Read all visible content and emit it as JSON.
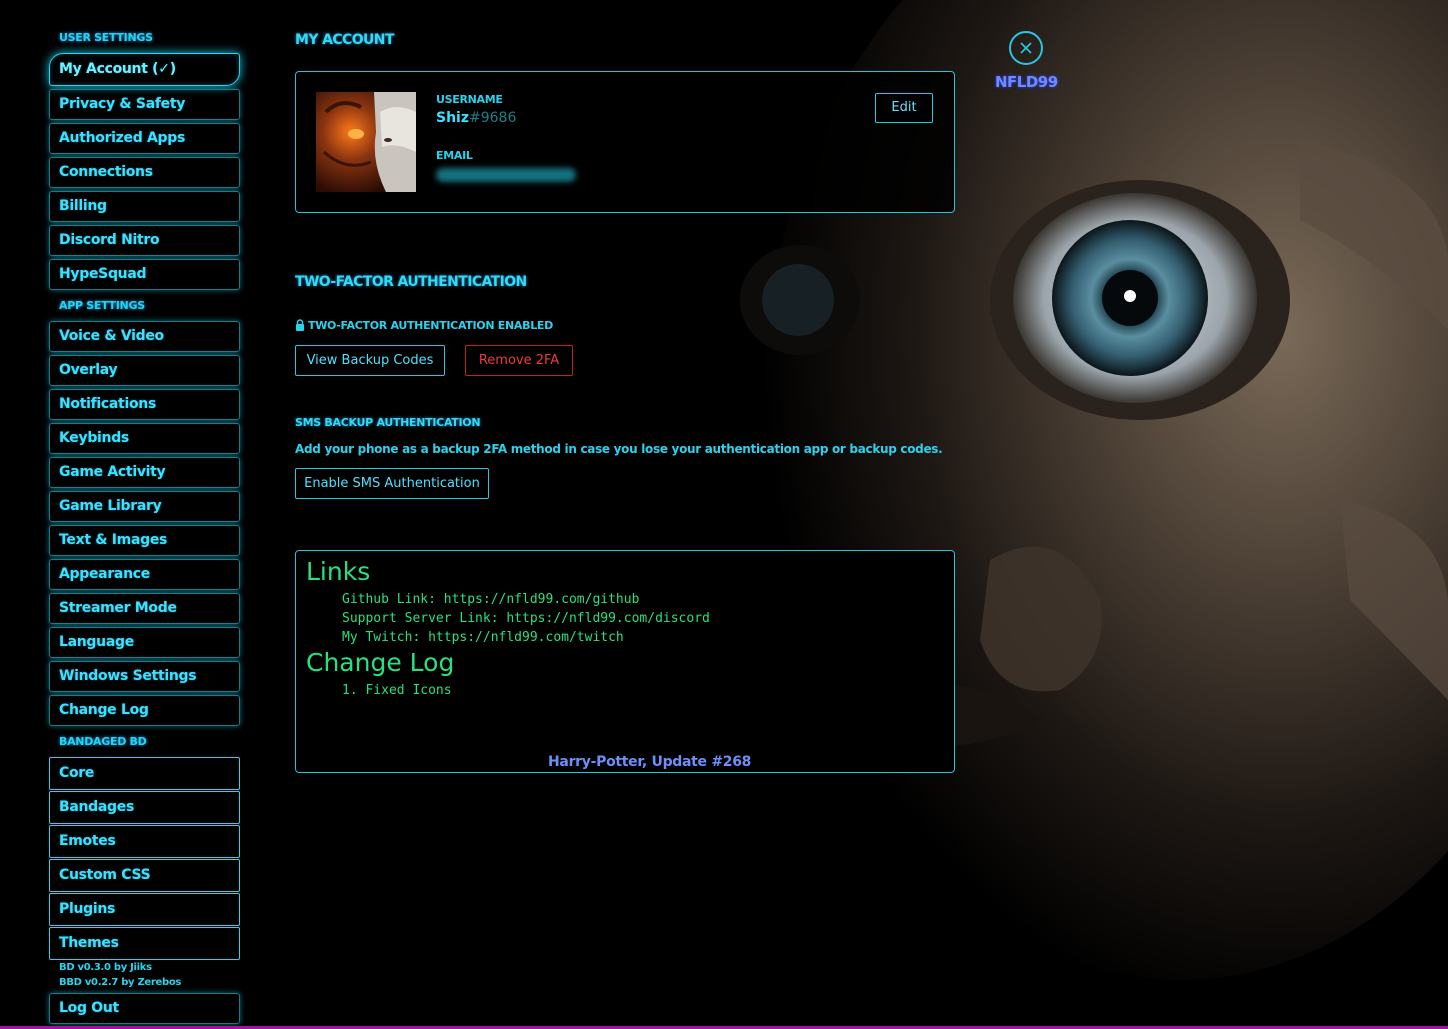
{
  "sidebar": {
    "user_settings_header": "USER SETTINGS",
    "user_items": [
      {
        "label": "My Account (✓)"
      },
      {
        "label": "Privacy & Safety"
      },
      {
        "label": "Authorized Apps"
      },
      {
        "label": "Connections"
      },
      {
        "label": "Billing"
      },
      {
        "label": "Discord Nitro"
      },
      {
        "label": "HypeSquad"
      }
    ],
    "app_settings_header": "APP SETTINGS",
    "app_items": [
      {
        "label": "Voice & Video"
      },
      {
        "label": "Overlay"
      },
      {
        "label": "Notifications"
      },
      {
        "label": "Keybinds"
      },
      {
        "label": "Game Activity"
      },
      {
        "label": "Game Library"
      },
      {
        "label": "Text & Images"
      },
      {
        "label": "Appearance"
      },
      {
        "label": "Streamer Mode"
      },
      {
        "label": "Language"
      },
      {
        "label": "Windows Settings"
      },
      {
        "label": "Change Log"
      }
    ],
    "bandaged_header": "BANDAGED BD",
    "bd_items": [
      {
        "label": "Core"
      },
      {
        "label": "Bandages"
      },
      {
        "label": "Emotes"
      },
      {
        "label": "Custom CSS"
      },
      {
        "label": "Plugins"
      },
      {
        "label": "Themes"
      }
    ],
    "version_1": "BD v0.3.0 by Jiiks",
    "version_2": "BBD v0.2.7 by Zerebos",
    "logout_label": "Log Out"
  },
  "account": {
    "title": "MY ACCOUNT",
    "username_label": "USERNAME",
    "username": "Shiz",
    "discriminator": "#9686",
    "email_label": "EMAIL",
    "edit_label": "Edit"
  },
  "two_factor": {
    "title": "TWO-FACTOR AUTHENTICATION",
    "status": "TWO-FACTOR AUTHENTICATION ENABLED",
    "view_backup_label": "View Backup Codes",
    "remove_label": "Remove 2FA"
  },
  "sms": {
    "title": "SMS BACKUP AUTHENTICATION",
    "description": "Add your phone as a backup 2FA method in case you lose your authentication app or backup codes.",
    "enable_label": "Enable SMS Authentication"
  },
  "links_box": {
    "links_heading": "Links",
    "links": [
      "Github Link: https://nfld99.com/github",
      "Support Server Link: https://nfld99.com/discord",
      "My Twitch: https://nfld99.com/twitch"
    ],
    "changelog_heading": "Change Log",
    "changelog": [
      "1. Fixed Icons"
    ],
    "footer": "Harry-Potter, Update #268"
  },
  "close": {
    "icon": "close-icon",
    "label": "NFLD99"
  },
  "colors": {
    "accent": "#29d3ee",
    "link_text": "#27e07e",
    "danger": "#f0383f",
    "footer": "#6d8ffa"
  }
}
